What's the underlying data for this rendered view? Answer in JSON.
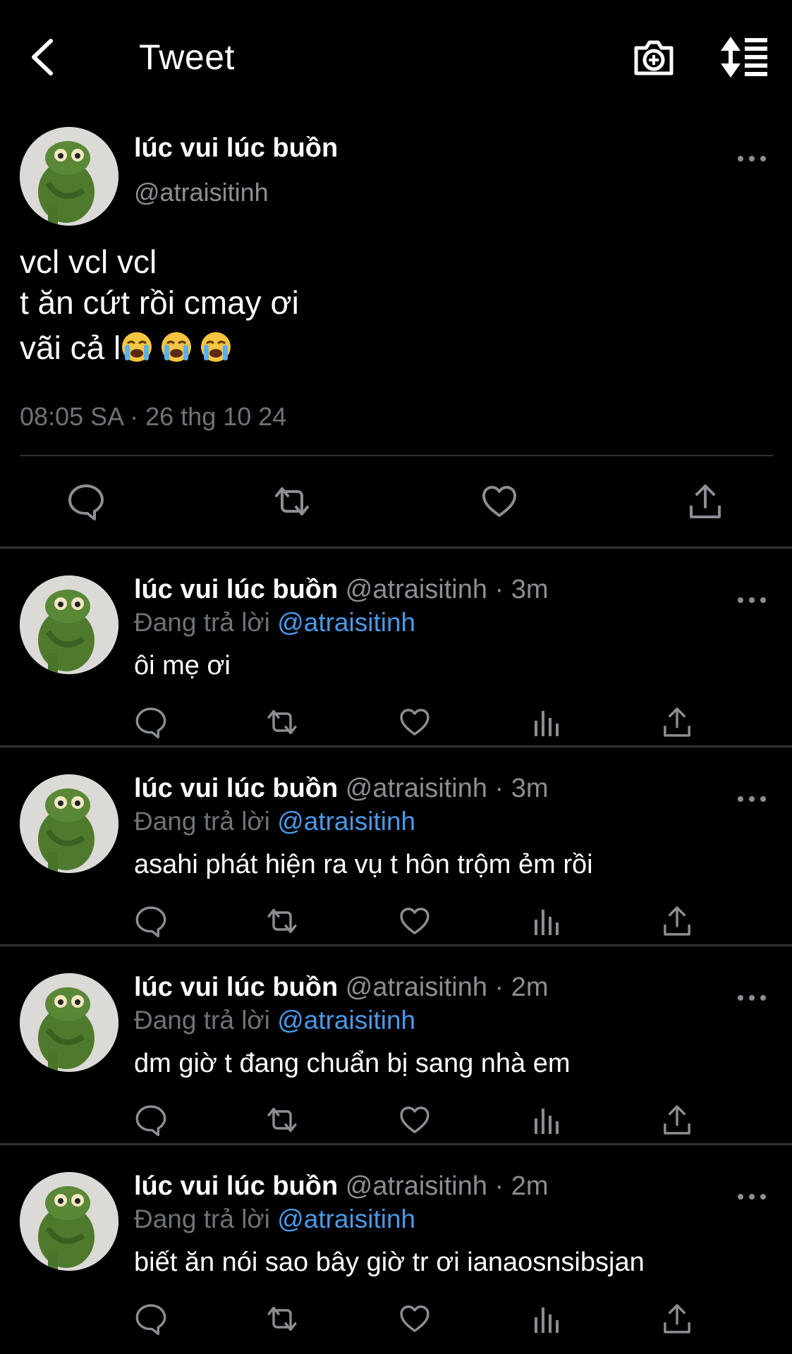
{
  "header": {
    "title": "Tweet",
    "icons": [
      "back-chevron-icon",
      "camera-add-icon",
      "sort-list-icon"
    ]
  },
  "main_tweet": {
    "display_name": "lúc vui lúc buồn",
    "handle": "@atraisitinh",
    "text_lines": [
      "vcl vcl vcl",
      "t ăn cứt rồi cmay ơi",
      "vãi cả l"
    ],
    "emoji": "loudly-crying-face x3",
    "timestamp": "08:05 SA · 26 thg 10 24",
    "actions": [
      "reply-icon",
      "retweet-icon",
      "like-icon",
      "share-icon"
    ]
  },
  "replies": [
    {
      "display_name": "lúc vui lúc buồn",
      "meta": "@atraisitinh · 3m",
      "replying_prefix": "Đang trả lời",
      "replying_to": "@atraisitinh",
      "text": "ôi mẹ ơi"
    },
    {
      "display_name": "lúc vui lúc buồn",
      "meta": "@atraisitinh · 3m",
      "replying_prefix": "Đang trả lời",
      "replying_to": "@atraisitinh",
      "text": "asahi phát hiện ra vụ t hôn trộm ẻm rồi"
    },
    {
      "display_name": "lúc vui lúc buồn",
      "meta": "@atraisitinh · 2m",
      "replying_prefix": "Đang trả lời",
      "replying_to": "@atraisitinh",
      "text": "dm giờ t đang chuẩn bị sang nhà em"
    },
    {
      "display_name": "lúc vui lúc buồn",
      "meta": "@atraisitinh · 2m",
      "replying_prefix": "Đang trả lời",
      "replying_to": "@atraisitinh",
      "text": "biết ăn nói sao bây giờ tr ơi ianaosnsibsjan"
    }
  ],
  "colors": {
    "background": "#000000",
    "text": "#ffffff",
    "secondary": "#8b8f94",
    "mention": "#4a99e9",
    "divider": "#2f3336"
  }
}
